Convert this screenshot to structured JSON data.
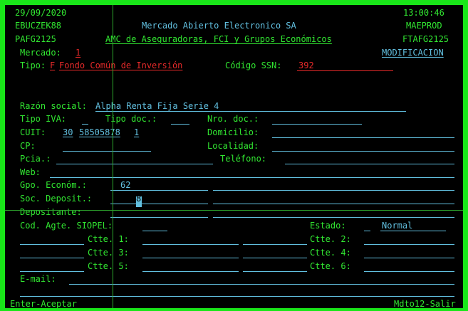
{
  "header": {
    "date": "29/09/2020",
    "time": "13:00:46",
    "user": "EBUCZEK88",
    "system": "Mercado Abierto Electronico SA",
    "module": "MAEPROD",
    "program": "PAFG2125",
    "subtitle": "AMC de Aseguradoras, FCI y Grupos Económicos",
    "screen_id": "FTAFG2125"
  },
  "mercado": {
    "label": "Mercado:",
    "value": "1"
  },
  "mode": "MODIFICACION",
  "tipo": {
    "label": "Tipo:",
    "code": "F",
    "description": "Fondo Común de Inversión"
  },
  "codigo_ssn": {
    "label": "Código SSN:",
    "value": "392"
  },
  "form": {
    "razon_social": {
      "label": "Razón social:",
      "value": "Alpha Renta Fija Serie 4"
    },
    "tipo_iva": {
      "label": "Tipo IVA:",
      "value": ""
    },
    "tipo_doc": {
      "label": "Tipo doc.:",
      "value": ""
    },
    "nro_doc": {
      "label": "Nro. doc.:",
      "value": ""
    },
    "cuit": {
      "label": "CUIT:",
      "prefix": "30",
      "number": "58505878",
      "check": "1"
    },
    "domicilio": {
      "label": "Domicilio:",
      "value": ""
    },
    "cp": {
      "label": "CP:",
      "value": ""
    },
    "localidad": {
      "label": "Localidad:",
      "value": ""
    },
    "pcia": {
      "label": "Pcia.:",
      "value": ""
    },
    "telefono": {
      "label": "Teléfono:",
      "value": ""
    },
    "web": {
      "label": "Web:",
      "value": ""
    },
    "gpo_econom": {
      "label": "Gpo. Económ.:",
      "value": "62"
    },
    "soc_deposit": {
      "label": "Soc. Deposit.:",
      "value": "8"
    },
    "depositante": {
      "label": "Depositante:",
      "value": ""
    },
    "cod_agte_siopel": {
      "label": "Cod. Agte. SIOPEL:",
      "value": ""
    },
    "estado": {
      "label": "Estado:",
      "code": "",
      "value": "Normal"
    },
    "ctte_labels": [
      "Ctte. 1:",
      "Ctte. 2:",
      "Ctte. 3:",
      "Ctte. 4:",
      "Ctte. 5:",
      "Ctte. 6:"
    ],
    "email": {
      "label": "E-mail:",
      "value": ""
    }
  },
  "footer": {
    "left": "Enter-Aceptar",
    "right": "Mdto12-Salir"
  },
  "colors": {
    "border": "#19e619",
    "label": "#31e631",
    "field": "#62c0e0",
    "highlight": "#e82a2a",
    "background": "#000000"
  }
}
